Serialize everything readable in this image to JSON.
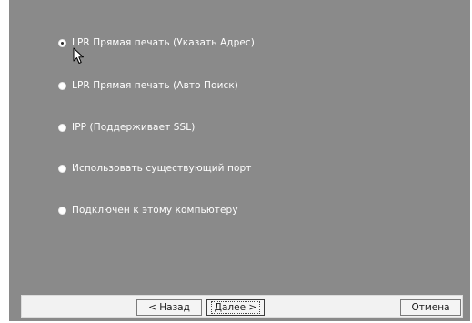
{
  "options": [
    {
      "label": "LPR Прямая печать (Указать Адрес)",
      "checked": true
    },
    {
      "label": "LPR Прямая печать (Авто Поиск)",
      "checked": false
    },
    {
      "label": "IPP (Поддерживает SSL)",
      "checked": false
    },
    {
      "label": "Использовать существующий порт",
      "checked": false
    },
    {
      "label": "Подключен к этому компьютеру",
      "checked": false
    }
  ],
  "buttons": {
    "back": "< Назад",
    "next": "Далее >",
    "cancel": "Отмена"
  },
  "icons": {
    "cursor": "mouse-pointer-icon",
    "radio": "radio-button-icon"
  }
}
